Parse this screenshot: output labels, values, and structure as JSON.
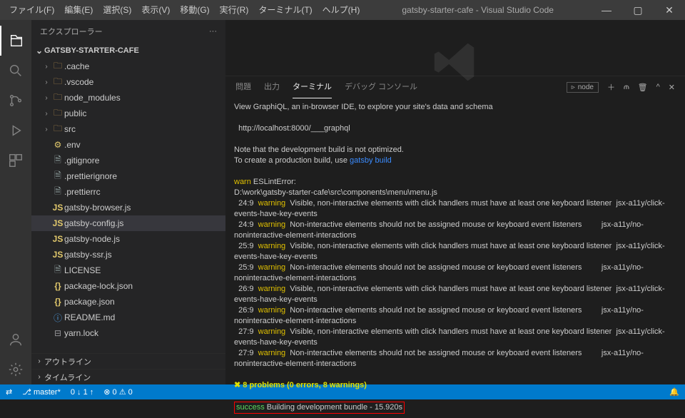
{
  "title": "gatsby-starter-cafe - Visual Studio Code",
  "menus": [
    "ファイル(F)",
    "編集(E)",
    "選択(S)",
    "表示(V)",
    "移動(G)",
    "実行(R)",
    "ターミナル(T)",
    "ヘルプ(H)"
  ],
  "sidebarHeader": "エクスプローラー",
  "projectName": "GATSBY-STARTER-CAFE",
  "tree": [
    {
      "t": "fold",
      "n": ".cache"
    },
    {
      "t": "fold",
      "n": ".vscode"
    },
    {
      "t": "fold",
      "n": "node_modules"
    },
    {
      "t": "fold",
      "n": "public"
    },
    {
      "t": "fold",
      "n": "src"
    },
    {
      "t": "env",
      "n": ".env"
    },
    {
      "t": "file",
      "n": ".gitignore"
    },
    {
      "t": "file",
      "n": ".prettierignore"
    },
    {
      "t": "file",
      "n": ".prettierrc"
    },
    {
      "t": "js",
      "n": "gatsby-browser.js"
    },
    {
      "t": "js",
      "n": "gatsby-config.js",
      "sel": true
    },
    {
      "t": "js",
      "n": "gatsby-node.js"
    },
    {
      "t": "js",
      "n": "gatsby-ssr.js"
    },
    {
      "t": "file",
      "n": "LICENSE"
    },
    {
      "t": "json",
      "n": "package-lock.json"
    },
    {
      "t": "json",
      "n": "package.json"
    },
    {
      "t": "md",
      "n": "README.md"
    },
    {
      "t": "lock",
      "n": "yarn.lock"
    }
  ],
  "collapsedSections": [
    "アウトライン",
    "タイムライン"
  ],
  "panelTabs": [
    "問題",
    "出力",
    "ターミナル",
    "デバッグ コンソール"
  ],
  "panelActiveTab": 2,
  "terminalSelector": "node",
  "terminalLines": [
    {
      "k": "txt",
      "s": "View GraphiQL, an in-browser IDE, to explore your site's data and schema"
    },
    {
      "k": "blank"
    },
    {
      "k": "txt",
      "s": "  http://localhost:8000/___graphql"
    },
    {
      "k": "blank"
    },
    {
      "k": "txt",
      "s": "Note that the development build is not optimized."
    },
    {
      "k": "mix",
      "parts": [
        {
          "c": "",
          "s": "To create a production build, use "
        },
        {
          "c": "lnk",
          "s": "gatsby build"
        }
      ]
    },
    {
      "k": "blank"
    },
    {
      "k": "mix",
      "parts": [
        {
          "c": "warn",
          "s": "warn"
        },
        {
          "c": "",
          "s": " ESLintError:"
        }
      ]
    },
    {
      "k": "txt",
      "s": "D:\\work\\gatsby-starter-cafe\\src\\components\\menu\\menu.js"
    },
    {
      "k": "mix",
      "parts": [
        {
          "c": "",
          "s": "  24:9  "
        },
        {
          "c": "warn",
          "s": "warning"
        },
        {
          "c": "",
          "s": "  Visible, non-interactive elements with click handlers must have at least one keyboard listener  jsx-a11y/click-events-have-key-events"
        }
      ]
    },
    {
      "k": "mix",
      "parts": [
        {
          "c": "",
          "s": "  24:9  "
        },
        {
          "c": "warn",
          "s": "warning"
        },
        {
          "c": "",
          "s": "  Non-interactive elements should not be assigned mouse or keyboard event listeners         jsx-a11y/no-noninteractive-element-interactions"
        }
      ]
    },
    {
      "k": "mix",
      "parts": [
        {
          "c": "",
          "s": "  25:9  "
        },
        {
          "c": "warn",
          "s": "warning"
        },
        {
          "c": "",
          "s": "  Visible, non-interactive elements with click handlers must have at least one keyboard listener  jsx-a11y/click-events-have-key-events"
        }
      ]
    },
    {
      "k": "mix",
      "parts": [
        {
          "c": "",
          "s": "  25:9  "
        },
        {
          "c": "warn",
          "s": "warning"
        },
        {
          "c": "",
          "s": "  Non-interactive elements should not be assigned mouse or keyboard event listeners         jsx-a11y/no-noninteractive-element-interactions"
        }
      ]
    },
    {
      "k": "mix",
      "parts": [
        {
          "c": "",
          "s": "  26:9  "
        },
        {
          "c": "warn",
          "s": "warning"
        },
        {
          "c": "",
          "s": "  Visible, non-interactive elements with click handlers must have at least one keyboard listener  jsx-a11y/click-events-have-key-events"
        }
      ]
    },
    {
      "k": "mix",
      "parts": [
        {
          "c": "",
          "s": "  26:9  "
        },
        {
          "c": "warn",
          "s": "warning"
        },
        {
          "c": "",
          "s": "  Non-interactive elements should not be assigned mouse or keyboard event listeners         jsx-a11y/no-noninteractive-element-interactions"
        }
      ]
    },
    {
      "k": "mix",
      "parts": [
        {
          "c": "",
          "s": "  27:9  "
        },
        {
          "c": "warn",
          "s": "warning"
        },
        {
          "c": "",
          "s": "  Visible, non-interactive elements with click handlers must have at least one keyboard listener  jsx-a11y/click-events-have-key-events"
        }
      ]
    },
    {
      "k": "mix",
      "parts": [
        {
          "c": "",
          "s": "  27:9  "
        },
        {
          "c": "warn",
          "s": "warning"
        },
        {
          "c": "",
          "s": "  Non-interactive elements should not be assigned mouse or keyboard event listeners         jsx-a11y/no-noninteractive-element-interactions"
        }
      ]
    },
    {
      "k": "blank"
    },
    {
      "k": "mix",
      "parts": [
        {
          "c": "probs",
          "s": "✖ 8 problems (0 errors, 8 warnings)"
        }
      ]
    },
    {
      "k": "blank"
    },
    {
      "k": "succline",
      "parts": [
        {
          "c": "succ",
          "s": "success"
        },
        {
          "c": "",
          "s": " Building development bundle - 15.920s"
        }
      ]
    }
  ],
  "status": {
    "branch": "master",
    "sync": "",
    "errors": "0",
    "warnings": "0",
    "diag": "0 ↓ 1 ↑",
    "bell": ""
  }
}
